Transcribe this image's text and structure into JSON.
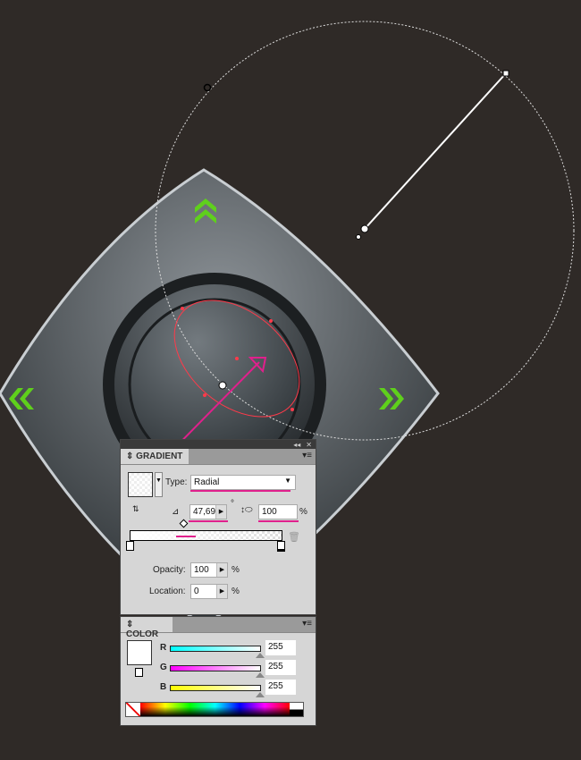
{
  "gradient_panel": {
    "title": "GRADIENT",
    "type_label": "Type:",
    "type_value": "Radial",
    "angle": "47,69",
    "aspect": "100",
    "percent": "%",
    "degree": "°",
    "opacity_label": "Opacity:",
    "opacity": "100",
    "location_label": "Location:",
    "location": "0"
  },
  "color_panel": {
    "title": "COLOR",
    "r_label": "R",
    "g_label": "G",
    "b_label": "B",
    "r": "255",
    "g": "255",
    "b": "255"
  },
  "colors": {
    "background": "#2f2a27",
    "annotation": "#e0208c",
    "arrow_green": "#5fd01c"
  }
}
